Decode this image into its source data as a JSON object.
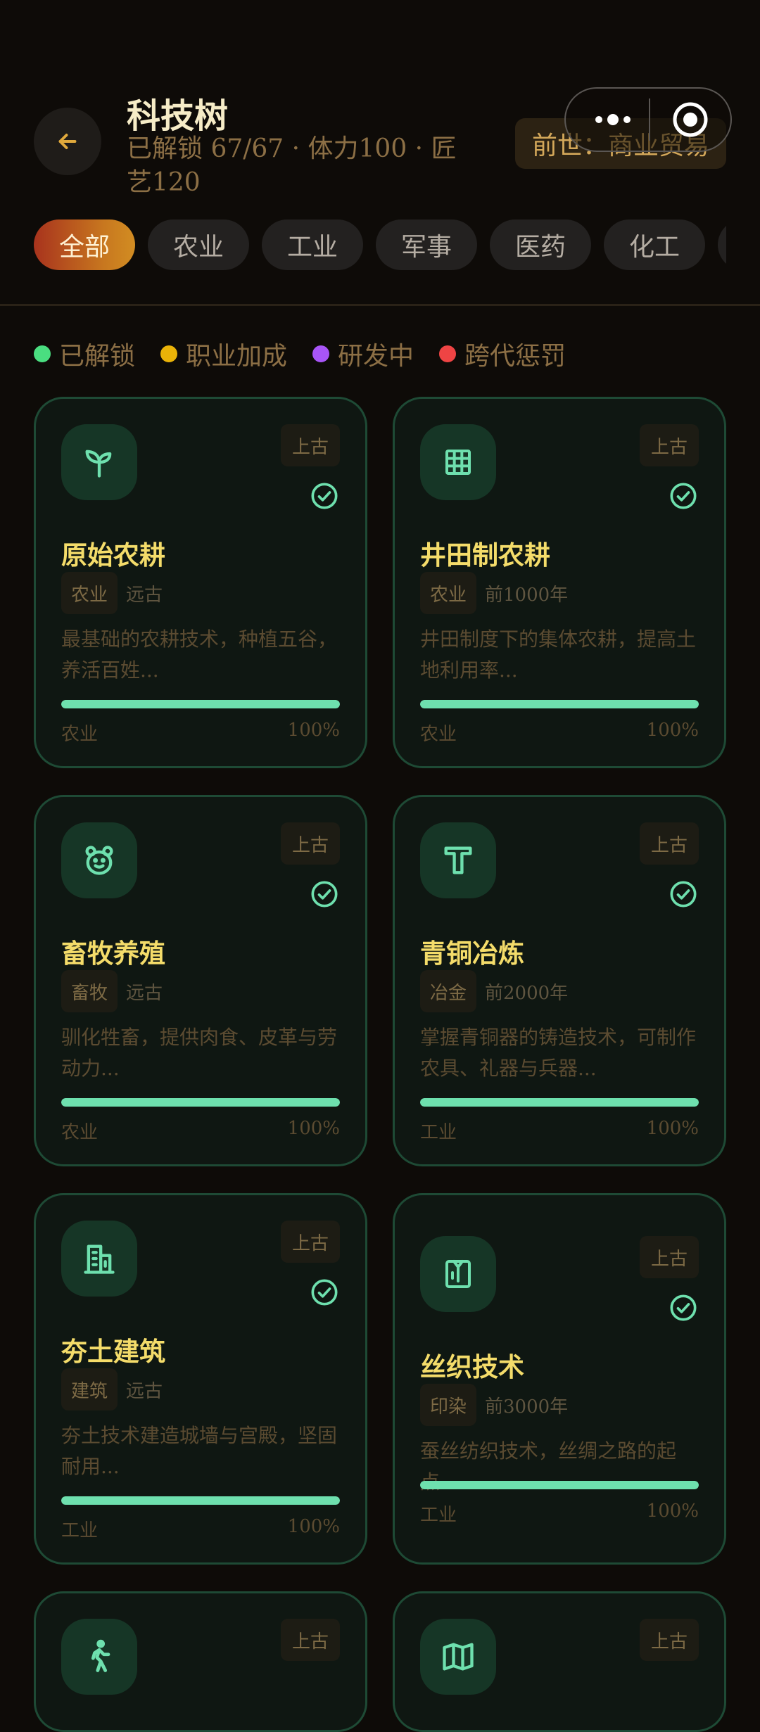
{
  "header": {
    "title": "科技树",
    "subtitle": "已解锁 67/67 · 体力100 · 匠艺120",
    "prev_life": "前世：商业贸易"
  },
  "tabs": [
    {
      "label": "全部",
      "active": true
    },
    {
      "label": "农业",
      "active": false
    },
    {
      "label": "工业",
      "active": false
    },
    {
      "label": "军事",
      "active": false
    },
    {
      "label": "医药",
      "active": false
    },
    {
      "label": "化工",
      "active": false
    },
    {
      "label": "",
      "active": false
    }
  ],
  "legend": [
    {
      "label": "已解锁",
      "color": "#4ade80"
    },
    {
      "label": "职业加成",
      "color": "#eab308"
    },
    {
      "label": "研发中",
      "color": "#a855f7"
    },
    {
      "label": "跨代惩罚",
      "color": "#ef4444"
    }
  ],
  "colors": {
    "accent_green": "#6ee0ae",
    "title_gold": "#f4dc6a",
    "card_border": "#1e4a35"
  },
  "techs": [
    {
      "icon": "sprout-icon",
      "era": "上古",
      "name": "原始农耕",
      "category": "农业",
      "period": "远古",
      "desc": "最基础的农耕技术，种植五谷，养活百姓...",
      "field": "农业",
      "progress_text": "100%",
      "progress": 1.0
    },
    {
      "icon": "grid-icon",
      "era": "上古",
      "name": "井田制农耕",
      "category": "农业",
      "period": "前1000年",
      "desc": "井田制度下的集体农耕，提高土地利用率...",
      "field": "农业",
      "progress_text": "100%",
      "progress": 1.0
    },
    {
      "icon": "bear-icon",
      "era": "上古",
      "name": "畜牧养殖",
      "category": "畜牧",
      "period": "远古",
      "desc": "驯化牲畜，提供肉食、皮革与劳动力...",
      "field": "农业",
      "progress_text": "100%",
      "progress": 1.0
    },
    {
      "icon": "hammer-icon",
      "era": "上古",
      "name": "青铜冶炼",
      "category": "冶金",
      "period": "前2000年",
      "desc": "掌握青铜器的铸造技术，可制作农具、礼器与兵器...",
      "field": "工业",
      "progress_text": "100%",
      "progress": 1.0
    },
    {
      "icon": "building-icon",
      "era": "上古",
      "name": "夯土建筑",
      "category": "建筑",
      "period": "远古",
      "desc": "夯土技术建造城墙与宫殿，坚固耐用...",
      "field": "工业",
      "progress_text": "100%",
      "progress": 1.0
    },
    {
      "icon": "shirt-icon",
      "era": "上古",
      "name": "丝织技术",
      "category": "印染",
      "period": "前3000年",
      "desc": "蚕丝纺织技术，丝绸之路的起点...",
      "field": "工业",
      "progress_text": "100%",
      "progress": 1.0
    },
    {
      "icon": "walk-icon",
      "era": "上古",
      "name": "",
      "category": "",
      "period": "",
      "desc": "",
      "field": "",
      "progress_text": "",
      "progress": 1.0
    },
    {
      "icon": "map-icon",
      "era": "上古",
      "name": "",
      "category": "",
      "period": "",
      "desc": "",
      "field": "",
      "progress_text": "",
      "progress": 1.0
    }
  ]
}
